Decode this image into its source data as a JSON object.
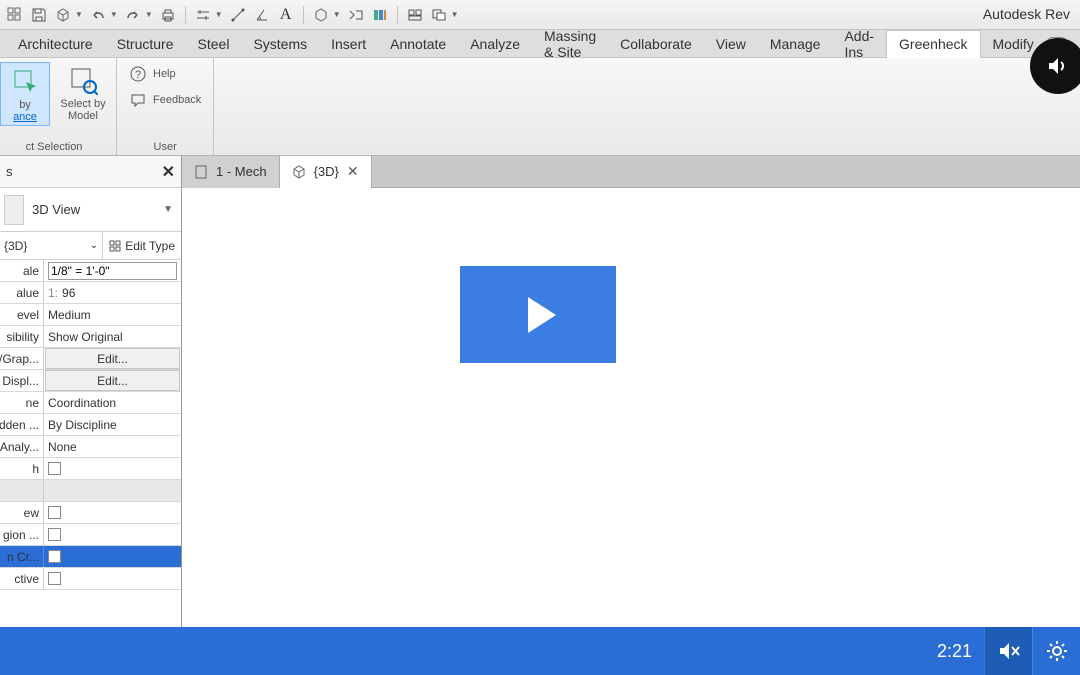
{
  "app_title": "Autodesk Rev",
  "qat_icons": [
    "grid",
    "save",
    "cube",
    "undo",
    "redo",
    "print",
    "align",
    "measure",
    "angle",
    "text",
    "view3d",
    "thinlines",
    "filter",
    "window",
    "switch"
  ],
  "ribbon_tabs": [
    "Architecture",
    "Structure",
    "Steel",
    "Systems",
    "Insert",
    "Annotate",
    "Analyze",
    "Massing & Site",
    "Collaborate",
    "View",
    "Manage",
    "Add-Ins",
    "Greenheck",
    "Modify"
  ],
  "active_ribbon_tab": 12,
  "ribbon": {
    "group1_btn1_line1": "by",
    "group1_btn1_line2": "ance",
    "group1_btn2_line1": "Select by",
    "group1_btn2_line2": "Model",
    "group1_label": "ct Selection",
    "group2_help": "Help",
    "group2_feedback": "Feedback",
    "group2_label": "User"
  },
  "doc_tabs": [
    {
      "label": "1 - Mech",
      "icon": "sheet",
      "active": false
    },
    {
      "label": "{3D}",
      "icon": "cube",
      "active": true
    }
  ],
  "props": {
    "title": "s",
    "type_name": "3D View",
    "instance": "{3D}",
    "edit_type": "Edit Type",
    "rows": [
      {
        "k": "ale",
        "v": "1/8\" = 1'-0\"",
        "kind": "input"
      },
      {
        "k": "alue",
        "v": "96",
        "prefix": "1:",
        "kind": "text"
      },
      {
        "k": "evel",
        "v": "Medium",
        "kind": "text"
      },
      {
        "k": "sibility",
        "v": "Show Original",
        "kind": "text"
      },
      {
        "k": "y/Grap...",
        "v": "Edit...",
        "kind": "button"
      },
      {
        "k": "Displ...",
        "v": "Edit...",
        "kind": "button"
      },
      {
        "k": "ne",
        "v": "Coordination",
        "kind": "text"
      },
      {
        "k": "idden ...",
        "v": "By Discipline",
        "kind": "text"
      },
      {
        "k": "Analy...",
        "v": "None",
        "kind": "text"
      },
      {
        "k": "h",
        "v": "",
        "kind": "check"
      },
      {
        "k": "",
        "v": "",
        "kind": "cat"
      },
      {
        "k": "ew",
        "v": "",
        "kind": "check"
      },
      {
        "k": "gion ...",
        "v": "",
        "kind": "check"
      },
      {
        "k": "n Cr...",
        "v": "",
        "kind": "check",
        "selected": true
      },
      {
        "k": "ctive",
        "v": "",
        "kind": "check"
      }
    ]
  },
  "video": {
    "time": "2:21"
  }
}
